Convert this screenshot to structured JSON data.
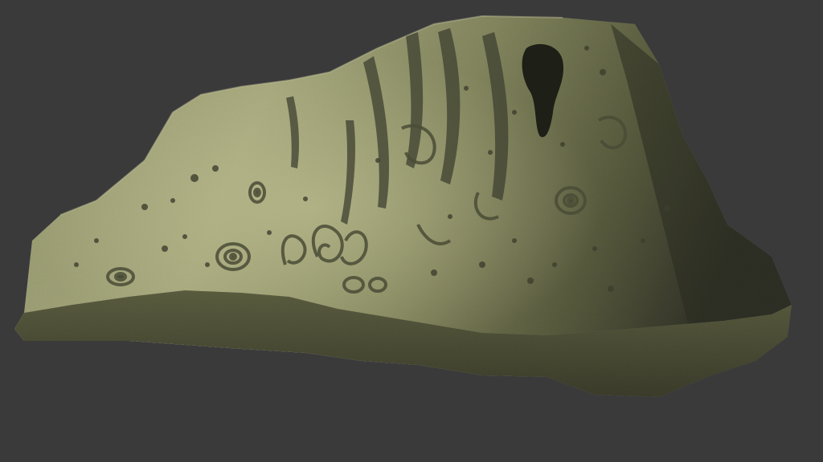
{
  "scene": {
    "background_color": "#3a3a3b",
    "subject": "rock-art-boulder-3d-scan",
    "colors": {
      "rock_highlight": "#b7b98d",
      "rock_mid": "#878a62",
      "rock_shadow": "#4c4e36",
      "rock_deep_shadow": "#2b2c20",
      "base_rubble": "#6a6b4a"
    }
  }
}
